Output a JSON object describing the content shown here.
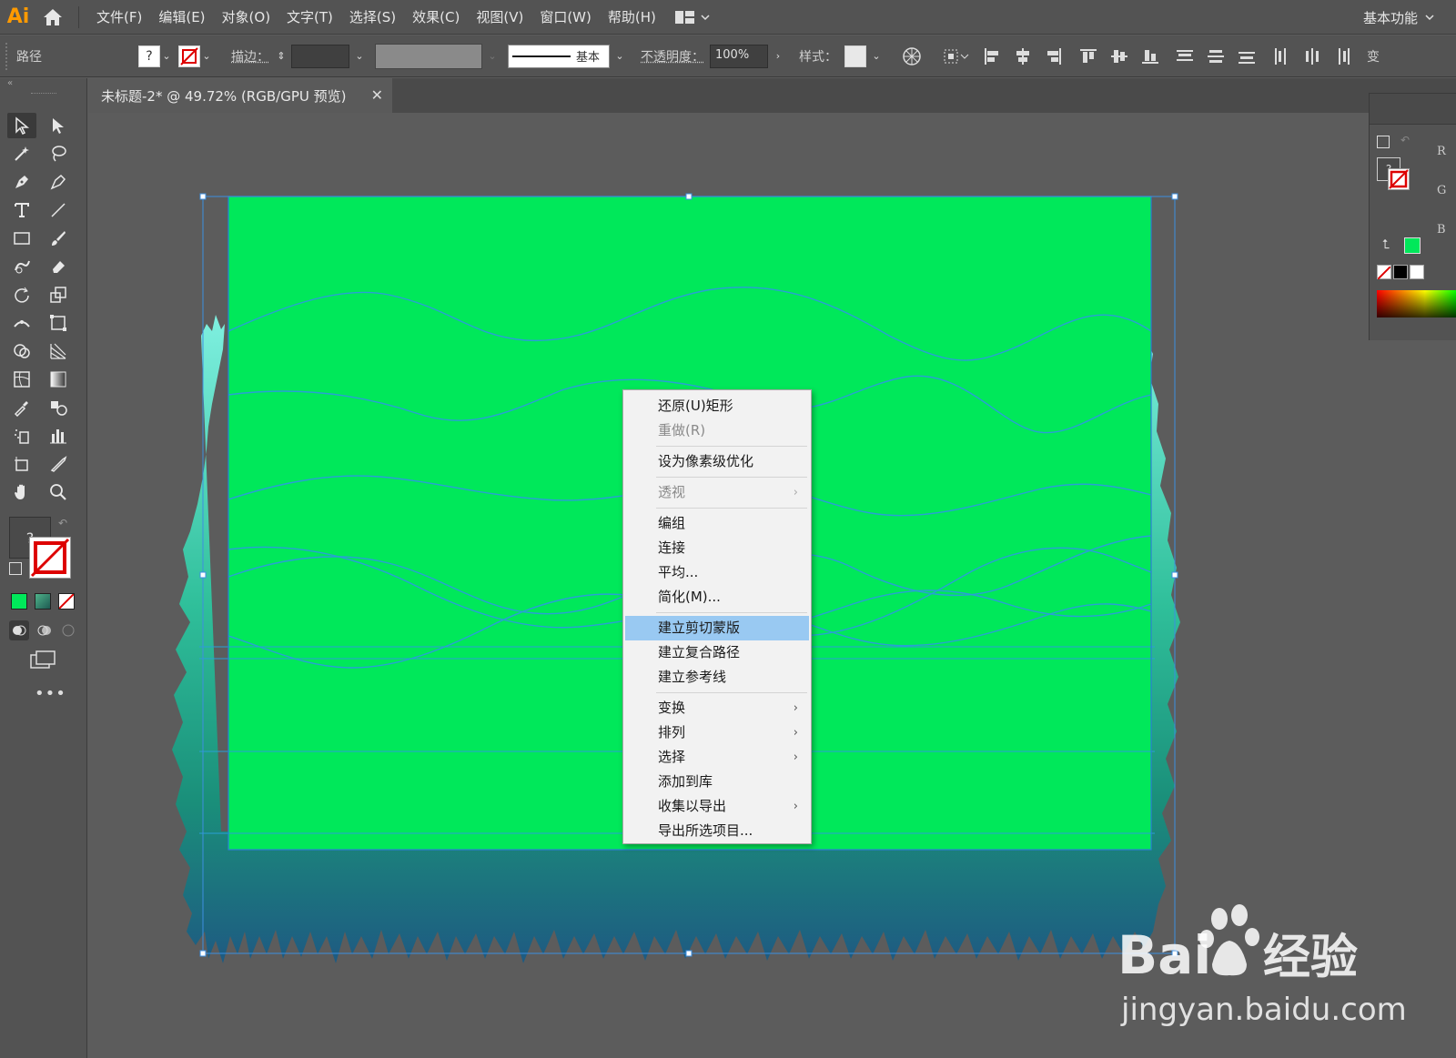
{
  "app": {
    "logo": "Ai",
    "workspace": "基本功能"
  },
  "menus": [
    "文件(F)",
    "编辑(E)",
    "对象(O)",
    "文字(T)",
    "选择(S)",
    "效果(C)",
    "视图(V)",
    "窗口(W)",
    "帮助(H)"
  ],
  "control_bar": {
    "selection_type": "路径",
    "stroke_label": "描边：",
    "stroke_style": "基本",
    "opacity_label": "不透明度：",
    "opacity_value": "100%",
    "style_label": "样式：",
    "right_edge": "变"
  },
  "document": {
    "tab_title": "未标题-2* @ 49.72% (RGB/GPU 预览)"
  },
  "color_panel": {
    "channels": [
      "R",
      "G",
      "B"
    ]
  },
  "colors": {
    "fill": "#00e85a",
    "accent": "#ff9a00",
    "gradient_top": "#5fe8d8",
    "gradient_bottom": "#1e5a82"
  },
  "context_menu": {
    "items": [
      {
        "label": "还原(U)矩形"
      },
      {
        "label": "重做(R)",
        "disabled": true
      },
      {
        "label": "设为像素级优化"
      },
      {
        "label": "透视",
        "disabled": true,
        "submenu": true
      },
      {
        "label": "编组"
      },
      {
        "label": "连接"
      },
      {
        "label": "平均..."
      },
      {
        "label": "简化(M)..."
      },
      {
        "label": "建立剪切蒙版",
        "highlighted": true
      },
      {
        "label": "建立复合路径"
      },
      {
        "label": "建立参考线"
      },
      {
        "label": "变换",
        "submenu": true
      },
      {
        "label": "排列",
        "submenu": true
      },
      {
        "label": "选择",
        "submenu": true
      },
      {
        "label": "添加到库"
      },
      {
        "label": "收集以导出",
        "submenu": true
      },
      {
        "label": "导出所选项目..."
      }
    ]
  },
  "watermark": {
    "brand": "Bai经验",
    "url": "jingyan.baidu.com"
  }
}
